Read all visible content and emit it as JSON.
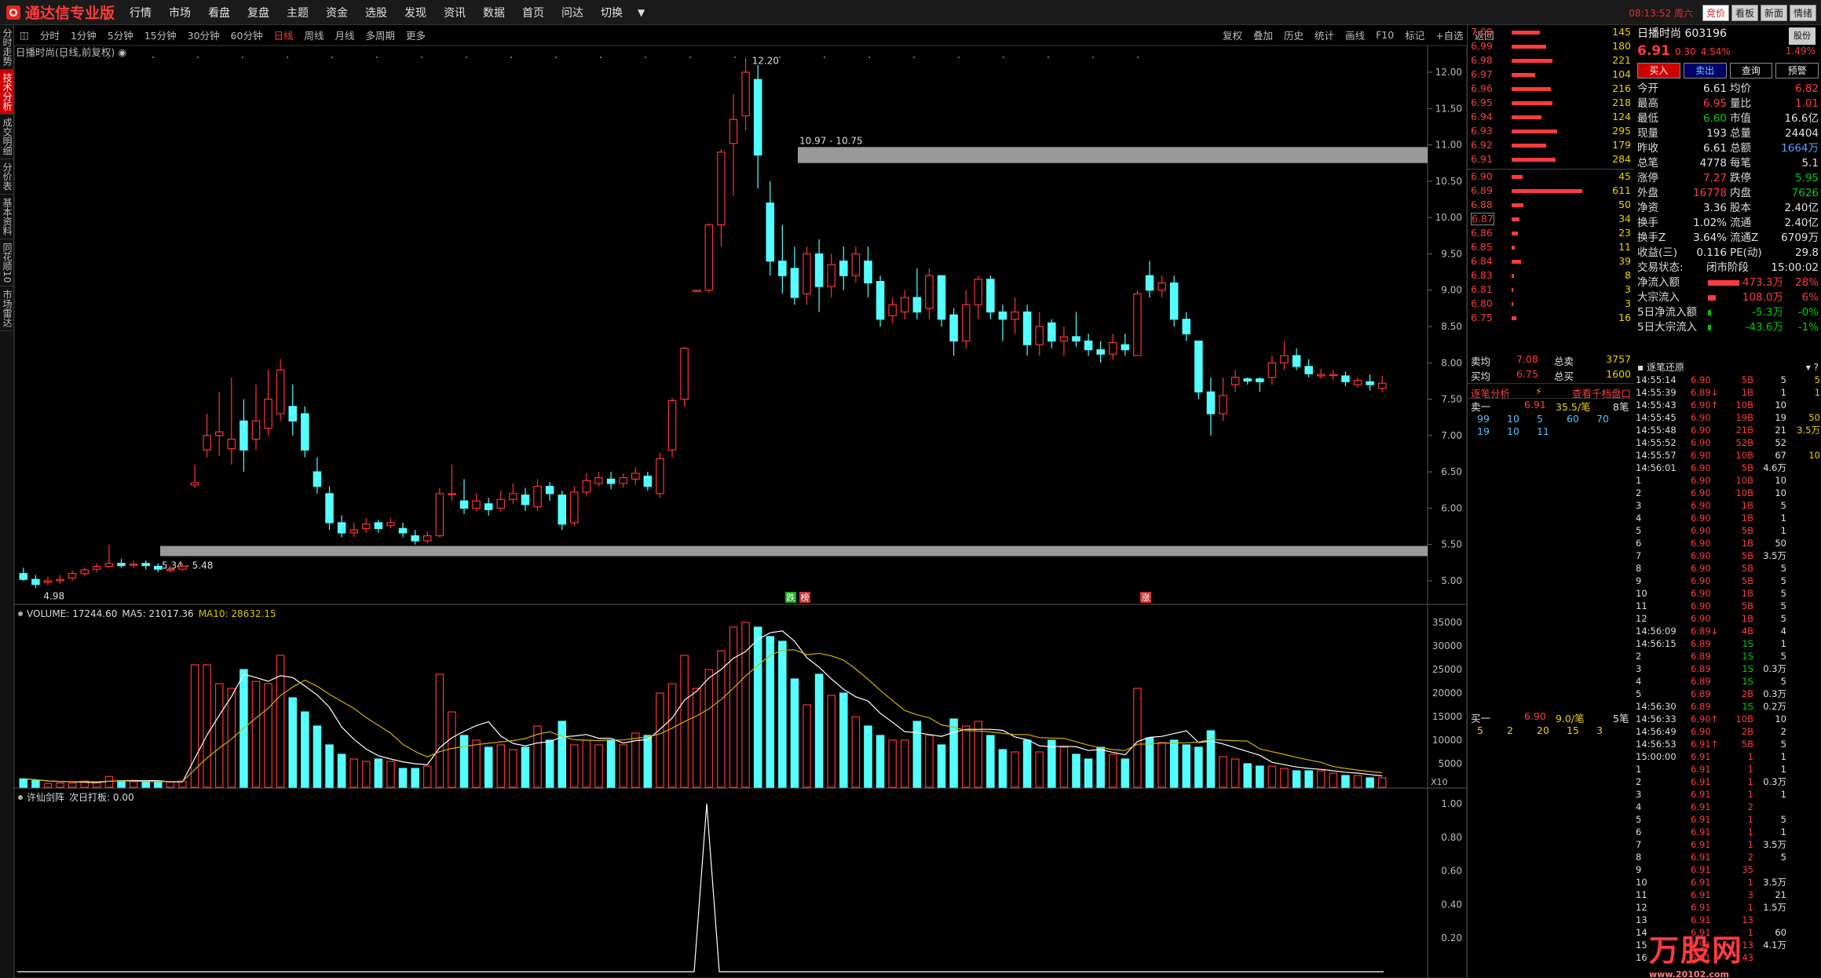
{
  "app": {
    "title": "通达信专业版",
    "clock": "08:13:52",
    "weekday": "周六"
  },
  "menu": [
    "行情",
    "市场",
    "看盘",
    "复盘",
    "主题",
    "资金",
    "选股",
    "发现",
    "资讯",
    "数据",
    "首页",
    "问达",
    "切换"
  ],
  "menu_more": "▼",
  "top_buttons": [
    "竞价",
    "看板",
    "新面",
    "情绪"
  ],
  "sidebar": [
    "分时走势",
    "技术分析",
    "成交明细",
    "分价表",
    "基本资料",
    "同花顺10",
    "市场雷达"
  ],
  "periods": [
    "分时",
    "1分钟",
    "5分钟",
    "15分钟",
    "30分钟",
    "60分钟",
    "日线",
    "周线",
    "月线",
    "多周期",
    "更多"
  ],
  "active_period": "日线",
  "toolbar_right": [
    "复权",
    "叠加",
    "历史",
    "统计",
    "画线",
    "F10",
    "标记",
    "+自选",
    "返回"
  ],
  "chart": {
    "stock_label": "日播时尚(日线,前复权)",
    "max_label": "12.20",
    "min_label": "4.98",
    "zone_high": "10.97 - 10.75",
    "zone_low": "5.34 - 5.48",
    "mark1": "跌",
    "mark2": "榜",
    "mark3": "涨",
    "y_ticks": [
      "12.00",
      "11.50",
      "11.00",
      "10.50",
      "10.00",
      "9.50",
      "9.00",
      "8.50",
      "8.00",
      "7.50",
      "7.00",
      "6.50",
      "6.00",
      "5.50",
      "5.00"
    ],
    "vol_header": "VOLUME: 17244.60",
    "vol_ma5": "MA5: 21017.36",
    "vol_ma10": "MA10: 28632.15",
    "vol_ticks": [
      "35000",
      "30000",
      "25000",
      "20000",
      "15000",
      "10000",
      "5000"
    ],
    "vol_unit": "X10",
    "ind_header": "许仙剑阵",
    "ind_sub": "次日打板: 0.00",
    "ind_ticks": [
      "1.00",
      "0.80",
      "0.60",
      "0.40",
      "0.20"
    ]
  },
  "chart_data": {
    "type": "candlestick",
    "candles": [
      [
        5.1,
        5.02,
        5.18,
        5.0
      ],
      [
        5.02,
        4.95,
        5.08,
        4.9
      ],
      [
        4.98,
        5.0,
        5.06,
        4.94
      ],
      [
        5.0,
        5.02,
        5.08,
        4.96
      ],
      [
        5.04,
        5.1,
        5.14,
        5.0
      ],
      [
        5.1,
        5.15,
        5.18,
        5.06
      ],
      [
        5.16,
        5.2,
        5.24,
        5.12
      ],
      [
        5.2,
        5.24,
        5.5,
        5.18
      ],
      [
        5.24,
        5.21,
        5.3,
        5.18
      ],
      [
        5.22,
        5.23,
        5.28,
        5.18
      ],
      [
        5.24,
        5.21,
        5.28,
        5.16
      ],
      [
        5.2,
        5.16,
        5.24,
        5.12
      ],
      [
        5.16,
        5.16,
        5.2,
        5.12
      ],
      [
        5.16,
        5.2,
        5.24,
        5.14
      ],
      [
        6.32,
        6.35,
        6.6,
        6.28
      ],
      [
        6.8,
        7.0,
        7.3,
        6.7
      ],
      [
        7.0,
        7.05,
        7.6,
        6.72
      ],
      [
        6.82,
        6.95,
        7.8,
        6.6
      ],
      [
        7.2,
        6.8,
        7.5,
        6.5
      ],
      [
        6.95,
        7.2,
        7.7,
        6.8
      ],
      [
        7.1,
        7.5,
        7.9,
        7.0
      ],
      [
        7.3,
        7.9,
        8.05,
        7.2
      ],
      [
        7.4,
        7.2,
        7.7,
        7.0
      ],
      [
        7.3,
        6.8,
        7.4,
        6.7
      ],
      [
        6.5,
        6.3,
        6.7,
        6.2
      ],
      [
        6.2,
        5.8,
        6.3,
        5.7
      ],
      [
        5.8,
        5.66,
        5.9,
        5.6
      ],
      [
        5.66,
        5.7,
        5.8,
        5.6
      ],
      [
        5.72,
        5.78,
        5.86,
        5.66
      ],
      [
        5.8,
        5.72,
        5.84,
        5.66
      ],
      [
        5.76,
        5.8,
        5.86,
        5.72
      ],
      [
        5.72,
        5.66,
        5.8,
        5.6
      ],
      [
        5.62,
        5.55,
        5.7,
        5.5
      ],
      [
        5.55,
        5.62,
        5.68,
        5.52
      ],
      [
        5.62,
        6.2,
        6.28,
        5.6
      ],
      [
        6.2,
        6.2,
        6.6,
        6.1
      ],
      [
        6.1,
        6.0,
        6.4,
        5.92
      ],
      [
        6.0,
        6.1,
        6.2,
        5.96
      ],
      [
        6.06,
        5.98,
        6.14,
        5.9
      ],
      [
        6.0,
        6.12,
        6.24,
        5.96
      ],
      [
        6.12,
        6.2,
        6.34,
        6.06
      ],
      [
        6.18,
        6.05,
        6.28,
        5.96
      ],
      [
        6.02,
        6.3,
        6.4,
        5.96
      ],
      [
        6.3,
        6.2,
        6.36,
        6.1
      ],
      [
        6.18,
        5.78,
        6.24,
        5.7
      ],
      [
        5.8,
        6.22,
        6.3,
        5.76
      ],
      [
        6.22,
        6.38,
        6.48,
        6.16
      ],
      [
        6.34,
        6.42,
        6.5,
        6.3
      ],
      [
        6.4,
        6.34,
        6.5,
        6.26
      ],
      [
        6.34,
        6.42,
        6.48,
        6.28
      ],
      [
        6.4,
        6.48,
        6.56,
        6.32
      ],
      [
        6.44,
        6.3,
        6.5,
        6.24
      ],
      [
        6.2,
        6.68,
        6.76,
        6.14
      ],
      [
        6.8,
        7.48,
        7.52,
        6.7
      ],
      [
        7.5,
        8.2,
        8.22,
        7.4
      ],
      [
        8.98,
        9.0,
        9.0,
        8.98
      ],
      [
        9.0,
        9.9,
        9.92,
        8.96
      ],
      [
        9.9,
        10.9,
        10.94,
        9.6
      ],
      [
        11.02,
        11.35,
        11.7,
        10.3
      ],
      [
        11.4,
        12.0,
        12.2,
        11.2
      ],
      [
        11.9,
        10.86,
        12.1,
        10.4
      ],
      [
        10.2,
        9.4,
        10.5,
        9.2
      ],
      [
        9.4,
        9.2,
        9.9,
        8.95
      ],
      [
        9.3,
        8.9,
        9.6,
        8.8
      ],
      [
        8.95,
        9.5,
        9.6,
        8.8
      ],
      [
        9.5,
        9.05,
        9.7,
        8.7
      ],
      [
        9.05,
        9.35,
        9.5,
        8.9
      ],
      [
        9.4,
        9.2,
        9.6,
        9.0
      ],
      [
        9.2,
        9.5,
        9.6,
        9.1
      ],
      [
        9.4,
        9.1,
        9.6,
        8.9
      ],
      [
        9.12,
        8.6,
        9.2,
        8.5
      ],
      [
        8.65,
        8.8,
        8.9,
        8.55
      ],
      [
        8.7,
        8.9,
        9.0,
        8.6
      ],
      [
        8.9,
        8.7,
        9.3,
        8.6
      ],
      [
        8.75,
        9.2,
        9.3,
        8.6
      ],
      [
        9.2,
        8.6,
        9.2,
        8.5
      ],
      [
        8.66,
        8.3,
        8.75,
        8.1
      ],
      [
        8.3,
        8.8,
        9.0,
        8.2
      ],
      [
        8.8,
        9.15,
        9.2,
        8.6
      ],
      [
        9.15,
        8.7,
        9.2,
        8.6
      ],
      [
        8.7,
        8.6,
        8.8,
        8.3
      ],
      [
        8.6,
        8.7,
        8.9,
        8.4
      ],
      [
        8.7,
        8.25,
        8.8,
        8.1
      ],
      [
        8.25,
        8.5,
        8.7,
        8.1
      ],
      [
        8.55,
        8.3,
        8.6,
        8.2
      ],
      [
        8.3,
        8.36,
        8.5,
        8.1
      ],
      [
        8.36,
        8.3,
        8.7,
        8.22
      ],
      [
        8.3,
        8.18,
        8.4,
        8.1
      ],
      [
        8.18,
        8.12,
        8.3,
        8.0
      ],
      [
        8.12,
        8.28,
        8.4,
        8.04
      ],
      [
        8.25,
        8.18,
        8.4,
        8.1
      ],
      [
        8.1,
        8.95,
        9.0,
        8.1
      ],
      [
        9.2,
        9.0,
        9.4,
        8.9
      ],
      [
        9.0,
        9.1,
        9.2,
        8.9
      ],
      [
        9.1,
        8.6,
        9.2,
        8.5
      ],
      [
        8.6,
        8.4,
        8.7,
        8.3
      ],
      [
        8.3,
        7.6,
        8.3,
        7.5
      ],
      [
        7.6,
        7.3,
        7.8,
        7.0
      ],
      [
        7.3,
        7.55,
        7.8,
        7.2
      ],
      [
        7.7,
        7.8,
        7.9,
        7.6
      ],
      [
        7.78,
        7.75,
        7.8,
        7.7
      ],
      [
        7.78,
        7.74,
        7.8,
        7.6
      ],
      [
        7.8,
        8.0,
        8.1,
        7.7
      ],
      [
        8.0,
        8.1,
        8.3,
        7.9
      ],
      [
        8.1,
        7.95,
        8.2,
        7.9
      ],
      [
        7.95,
        7.85,
        8.05,
        7.8
      ],
      [
        7.82,
        7.84,
        7.92,
        7.78
      ],
      [
        7.84,
        7.84,
        7.9,
        7.76
      ],
      [
        7.82,
        7.74,
        7.88,
        7.68
      ],
      [
        7.7,
        7.76,
        7.8,
        7.66
      ],
      [
        7.74,
        7.7,
        7.84,
        7.62
      ],
      [
        7.65,
        7.72,
        7.82,
        7.6
      ]
    ],
    "volume": [
      1800,
      1400,
      800,
      900,
      900,
      1300,
      1000,
      2300,
      1400,
      1200,
      1100,
      1000,
      1100,
      1300,
      26000,
      26000,
      22000,
      21000,
      25000,
      22500,
      22000,
      28000,
      19000,
      16000,
      13000,
      9000,
      7000,
      6000,
      5500,
      6000,
      5500,
      4000,
      4000,
      4500,
      24000,
      16000,
      11000,
      10000,
      8500,
      9000,
      8000,
      8500,
      13000,
      10000,
      14000,
      9000,
      10000,
      9000,
      10000,
      9000,
      11500,
      11000,
      20000,
      22000,
      28000,
      21000,
      25000,
      29000,
      34000,
      35000,
      34000,
      32000,
      31000,
      23000,
      17500,
      24000,
      19500,
      20000,
      15000,
      13000,
      11000,
      10000,
      10000,
      14000,
      11000,
      9000,
      14500,
      13000,
      14000,
      11000,
      8000,
      7500,
      10000,
      7500,
      10000,
      8500,
      7000,
      6000,
      8500,
      7000,
      6000,
      21000,
      10500,
      9500,
      10000,
      9000,
      8500,
      12000,
      6500,
      6000,
      5000,
      4500,
      4500,
      4000,
      3500,
      3500,
      3500,
      3000,
      2500,
      2500,
      2000,
      2000
    ],
    "signal_peak_index": 69
  },
  "orderbook": {
    "asks": [
      [
        "7.00",
        145,
        36
      ],
      [
        "6.99",
        180,
        44
      ],
      [
        "6.98",
        221,
        52
      ],
      [
        "6.97",
        104,
        30
      ],
      [
        "6.96",
        216,
        50
      ],
      [
        "6.95",
        218,
        52
      ],
      [
        "6.94",
        124,
        38
      ],
      [
        "6.93",
        295,
        58
      ],
      [
        "6.92",
        179,
        44
      ],
      [
        "6.91",
        284,
        56
      ]
    ],
    "bids": [
      [
        "6.90",
        45,
        14
      ],
      [
        "6.89",
        611,
        90
      ],
      [
        "6.88",
        50,
        15
      ],
      [
        "6.87",
        34,
        10
      ],
      [
        "6.86",
        23,
        8
      ],
      [
        "6.85",
        11,
        4
      ],
      [
        "6.84",
        39,
        12
      ],
      [
        "6.83",
        8,
        3
      ],
      [
        "6.81",
        3,
        2
      ],
      [
        "6.80",
        3,
        2
      ],
      [
        "6.75",
        16,
        6
      ]
    ]
  },
  "stock": {
    "name": "日播时尚",
    "code": "603196",
    "price": "6.91",
    "change": "0.30",
    "pct": "4.54%",
    "margin": "1.49%",
    "btn": "股份",
    "buy": "买入",
    "sell": "卖出",
    "query": "查询",
    "alert": "预警",
    "stats": [
      [
        "今开",
        "6.61",
        "均价",
        "6.82"
      ],
      [
        "最高",
        "6.95",
        "量比",
        "1.01"
      ],
      [
        "最低",
        "6.60",
        "市值",
        "16.6亿"
      ],
      [
        "现量",
        "193",
        "总量",
        "24404"
      ],
      [
        "昨收",
        "6.61",
        "总额",
        "1664万"
      ],
      [
        "总笔",
        "4778",
        "每笔",
        "5.1"
      ],
      [
        "涨停",
        "7.27",
        "跌停",
        "5.95"
      ],
      [
        "外盘",
        "16778",
        "内盘",
        "7626"
      ],
      [
        "净资",
        "3.36",
        "股本",
        "2.40亿"
      ],
      [
        "换手",
        "1.02%",
        "流通",
        "2.40亿"
      ],
      [
        "换手Z",
        "3.64%",
        "流通Z",
        "6709万"
      ],
      [
        "收益(三)",
        "0.116",
        "PE(动)",
        "29.8"
      ]
    ],
    "state_label": "交易状态:",
    "state": "闭市阶段",
    "time": "15:00:02",
    "flows": [
      [
        "净流入额",
        "473.3万",
        "28%"
      ],
      [
        "大宗流入",
        "108.0万",
        "6%"
      ],
      [
        "5日净流入额",
        "-5.3万",
        "-0%"
      ],
      [
        "5日大宗流入",
        "-43.6万",
        "-1%"
      ]
    ],
    "sell_avg": [
      "卖均",
      "7.08",
      "总卖",
      "3757"
    ],
    "buy_avg": [
      "买均",
      "6.75",
      "总买",
      "1600"
    ],
    "analyze": "逐笔分析",
    "depth": "查看千档盘口",
    "sell1": [
      "卖一",
      "6.91",
      "35.5/笔",
      "8笔"
    ],
    "sell1_q": [
      "99",
      "10",
      "5",
      "60",
      "70",
      "19",
      "10",
      "11"
    ],
    "buy1": [
      "买一",
      "6.90",
      "9.0/笔",
      "5笔"
    ],
    "buy1_q": [
      "5",
      "2",
      "20",
      "15",
      "3"
    ]
  },
  "ticks": {
    "title": "逐笔还原",
    "rows": [
      [
        "14:55:14",
        "6.90",
        "5B",
        "5",
        "5"
      ],
      [
        "14:55:39",
        "6.89↓",
        "1B",
        "1",
        "1"
      ],
      [
        "14:55:43",
        "6.90↑",
        "10B",
        "10",
        ""
      ],
      [
        "14:55:45",
        "6.90",
        "19B",
        "19",
        "50"
      ],
      [
        "14:55:48",
        "6.90",
        "21B",
        "21",
        "3.5万"
      ],
      [
        "14:55:52",
        "6.90",
        "52B",
        "52",
        ""
      ],
      [
        "14:55:57",
        "6.90",
        "10B",
        "67",
        "10"
      ],
      [
        "14:56:01",
        "6.90",
        "5B",
        "4.6万",
        ""
      ],
      [
        "1",
        "6.90",
        "10B",
        "10",
        ""
      ],
      [
        "2",
        "6.90",
        "10B",
        "10",
        ""
      ],
      [
        "3",
        "6.90",
        "1B",
        "5",
        ""
      ],
      [
        "4",
        "6.90",
        "1B",
        "1",
        ""
      ],
      [
        "5",
        "6.90",
        "5B",
        "1",
        ""
      ],
      [
        "6",
        "6.90",
        "1B",
        "50",
        ""
      ],
      [
        "7",
        "6.90",
        "5B",
        "3.5万",
        ""
      ],
      [
        "8",
        "6.90",
        "5B",
        "5",
        ""
      ],
      [
        "9",
        "6.90",
        "5B",
        "5",
        ""
      ],
      [
        "10",
        "6.90",
        "1B",
        "5",
        ""
      ],
      [
        "11",
        "6.90",
        "5B",
        "5",
        ""
      ],
      [
        "12",
        "6.90",
        "1B",
        "5",
        ""
      ],
      [
        "14:56:09",
        "6.89↓",
        "4B",
        "4",
        ""
      ],
      [
        "14:56:15",
        "6.89",
        "1S",
        "1",
        ""
      ],
      [
        "2",
        "6.89",
        "1S",
        "5",
        ""
      ],
      [
        "3",
        "6.89",
        "1S",
        "0.3万",
        ""
      ],
      [
        "4",
        "6.89",
        "1S",
        "5",
        ""
      ],
      [
        "5",
        "6.89",
        "2B",
        "0.3万",
        ""
      ],
      [
        "14:56:30",
        "6.89",
        "1S",
        "0.2万",
        ""
      ],
      [
        "14:56:33",
        "6.90↑",
        "10B",
        "10",
        ""
      ],
      [
        "14:56:49",
        "6.90",
        "2B",
        "2",
        ""
      ],
      [
        "14:56:53",
        "6.91↑",
        "5B",
        "5",
        ""
      ],
      [
        "15:00:00",
        "6.91",
        "1",
        "1",
        ""
      ],
      [
        "1",
        "6.91",
        "1",
        "1",
        ""
      ],
      [
        "2",
        "6.91",
        "1",
        "0.3万",
        ""
      ],
      [
        "3",
        "6.91",
        "1",
        "1",
        ""
      ],
      [
        "4",
        "6.91",
        "2",
        "",
        ""
      ],
      [
        "5",
        "6.91",
        "1",
        "5",
        ""
      ],
      [
        "6",
        "6.91",
        "1",
        "1",
        ""
      ],
      [
        "7",
        "6.91",
        "1",
        "3.5万",
        ""
      ],
      [
        "8",
        "6.91",
        "2",
        "5",
        ""
      ],
      [
        "9",
        "6.91",
        "35",
        "",
        ""
      ],
      [
        "10",
        "6.91",
        "1",
        "3.5万",
        ""
      ],
      [
        "11",
        "6.91",
        "3",
        "21",
        ""
      ],
      [
        "12",
        "6.91",
        "1",
        "1.5万",
        ""
      ],
      [
        "13",
        "6.91",
        "13",
        "",
        ""
      ],
      [
        "14",
        "6.91",
        "1",
        "60",
        ""
      ],
      [
        "15",
        "6.91",
        "13",
        "4.1万",
        ""
      ],
      [
        "16",
        "6.91",
        "43",
        "",
        ""
      ]
    ]
  },
  "watermark": {
    "text": "万股网",
    "url": "www.20102.com"
  }
}
